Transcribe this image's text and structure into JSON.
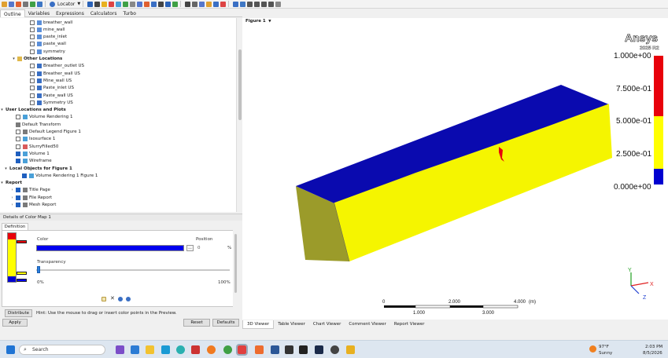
{
  "toolbar": {
    "locator_label": "Locator"
  },
  "tabs": [
    "Outline",
    "Variables",
    "Expressions",
    "Calculators",
    "Turbo"
  ],
  "tree": [
    {
      "label": "breather_wall",
      "indent": 38,
      "chk": false,
      "icon": "#5b8fd9",
      "bold": false
    },
    {
      "label": "mine_wall",
      "indent": 38,
      "chk": false,
      "icon": "#5b8fd9",
      "bold": false
    },
    {
      "label": "paste_inlet",
      "indent": 38,
      "chk": false,
      "icon": "#5b8fd9",
      "bold": false
    },
    {
      "label": "paste_wall",
      "indent": 38,
      "chk": false,
      "icon": "#5b8fd9",
      "bold": false
    },
    {
      "label": "symmetry",
      "indent": 38,
      "chk": false,
      "icon": "#5b8fd9",
      "bold": false
    },
    {
      "label": "Other Locations",
      "indent": 22,
      "chk": null,
      "icon": "#e0b84a",
      "bold": true,
      "exp": "v"
    },
    {
      "label": "Breather_outlet US",
      "indent": 38,
      "chk": false,
      "icon": "#3a6fc4",
      "bold": false
    },
    {
      "label": "Breather_wall US",
      "indent": 38,
      "chk": false,
      "icon": "#3a6fc4",
      "bold": false
    },
    {
      "label": "Mine_wall US",
      "indent": 38,
      "chk": false,
      "icon": "#3a6fc4",
      "bold": false
    },
    {
      "label": "Paste_inlet US",
      "indent": 38,
      "chk": false,
      "icon": "#3a6fc4",
      "bold": false
    },
    {
      "label": "Paste_wall US",
      "indent": 38,
      "chk": false,
      "icon": "#3a6fc4",
      "bold": false
    },
    {
      "label": "Symmetry US",
      "indent": 38,
      "chk": false,
      "icon": "#3a6fc4",
      "bold": false
    },
    {
      "label": "User Locations and Plots",
      "indent": 4,
      "chk": null,
      "icon": null,
      "bold": true,
      "exp": "v"
    },
    {
      "label": "Volume Rendering 1",
      "indent": 20,
      "chk": false,
      "icon": "#4aa0d8",
      "bold": false
    },
    {
      "label": "Default Transform",
      "indent": 20,
      "chk": null,
      "icon": "#7a7a7a",
      "bold": false
    },
    {
      "label": "Default Legend Figure 1",
      "indent": 20,
      "chk": false,
      "icon": "#7a7a7a",
      "bold": false
    },
    {
      "label": "Isosurface 1",
      "indent": 20,
      "chk": false,
      "icon": "#4aa0d8",
      "bold": false
    },
    {
      "label": "SlurryFilled50",
      "indent": 20,
      "chk": false,
      "icon": "#d95b5b",
      "bold": false
    },
    {
      "label": "Volume 1",
      "indent": 20,
      "chk": true,
      "icon": "#4aa0d8",
      "bold": false
    },
    {
      "label": "Wireframe",
      "indent": 20,
      "chk": true,
      "icon": "#4aa0d8",
      "bold": false
    },
    {
      "label": "Local Objects for Figure 1",
      "indent": 12,
      "chk": null,
      "icon": null,
      "bold": true,
      "exp": "v"
    },
    {
      "label": "Volume Rendering 1 Figure 1",
      "indent": 28,
      "chk": true,
      "icon": "#4aa0d8",
      "bold": false
    },
    {
      "label": "Report",
      "indent": 4,
      "chk": null,
      "icon": null,
      "bold": true,
      "exp": "v"
    },
    {
      "label": "Title Page",
      "indent": 20,
      "chk": true,
      "icon": "#7a7a7a",
      "bold": false,
      "exp": ">"
    },
    {
      "label": "File Report",
      "indent": 20,
      "chk": true,
      "icon": "#7a7a7a",
      "bold": false,
      "exp": ">"
    },
    {
      "label": "Mesh Report",
      "indent": 20,
      "chk": true,
      "icon": "#7a7a7a",
      "bold": false,
      "exp": ">"
    }
  ],
  "details": {
    "title": "Details of Color Map 1",
    "tab": "Definition",
    "color_label": "Color",
    "color_value": "#0000ee",
    "dots": "...",
    "position_label": "Position",
    "position_value": "0",
    "position_unit": "%",
    "transparency_label": "Transparency",
    "transparency_value": 0.0,
    "min_label": "0%",
    "max_label": "100%",
    "distribute_label": "Distribute",
    "hint": "Hint: Use the mouse to drag or insert color points in the Preview.",
    "apply_label": "Apply",
    "reset_label": "Reset",
    "defaults_label": "Defaults"
  },
  "viewer": {
    "figure_label": "Figure 1",
    "brand": "Ansys",
    "version": "2025 R2",
    "legend_ticks": [
      "1.000e+00",
      "7.500e-01",
      "5.000e-01",
      "2.500e-01",
      "0.000e+00"
    ],
    "scale_top": [
      "0",
      "2.000",
      "4.000",
      "(m)"
    ],
    "scale_bottom": [
      "1.000",
      "3.000"
    ],
    "axis_labels": {
      "y": "Y",
      "x": "X",
      "z": "Z"
    },
    "colors": {
      "top": "#0a0aaf",
      "side": "#f5f500",
      "dark_side": "#8a8a1a",
      "red": "#e8000b"
    }
  },
  "viewer_tabs": [
    "3D Viewer",
    "Table Viewer",
    "Chart Viewer",
    "Comment Viewer",
    "Report Viewer"
  ],
  "taskbar": {
    "search_placeholder": "Search",
    "weather_temp": "97°F",
    "weather_cond": "Sunny",
    "time": "2:03 PM",
    "date": "8/5/2026"
  }
}
